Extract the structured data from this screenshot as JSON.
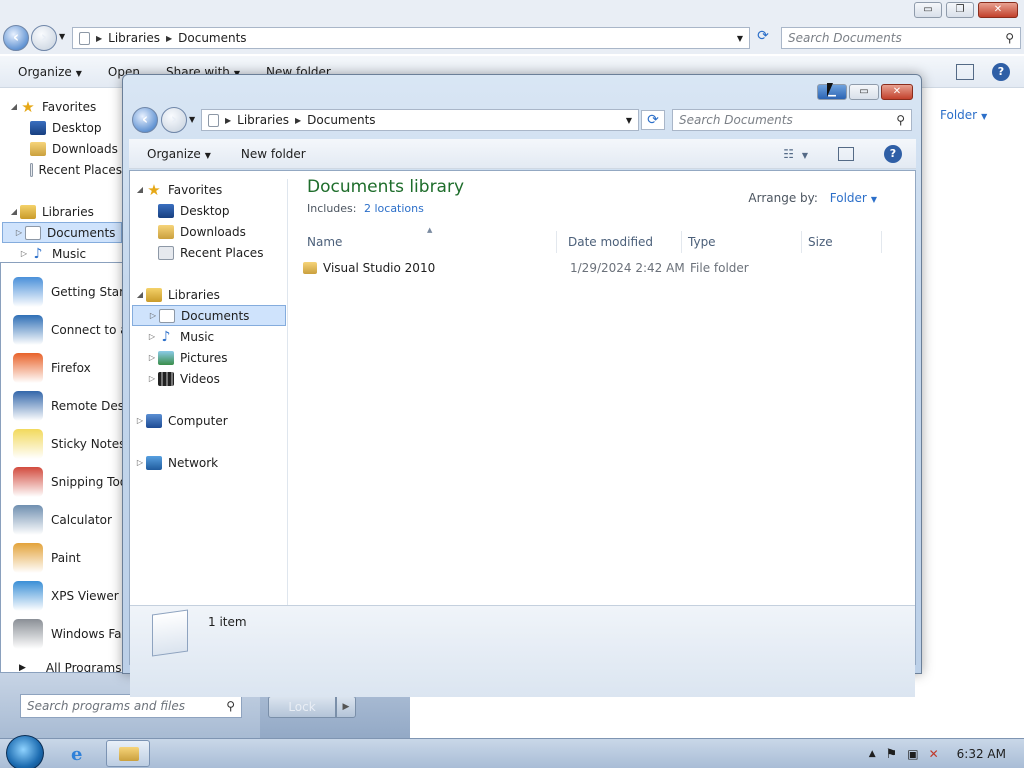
{
  "bg": {
    "caption": {
      "min": "▭",
      "max": "❐",
      "close": "✕"
    },
    "address": {
      "part1": "Libraries",
      "part2": "Documents"
    },
    "search_placeholder": "Search Documents",
    "cmd": {
      "organize": "Organize",
      "open": "Open",
      "share": "Share with",
      "new_folder": "New folder"
    },
    "arrange_value": "Folder",
    "nav": {
      "favorites": "Favorites",
      "desktop": "Desktop",
      "downloads": "Downloads",
      "recent": "Recent Places",
      "libraries": "Libraries",
      "documents": "Documents",
      "music": "Music"
    }
  },
  "start_menu": {
    "items": [
      {
        "label": "Getting Started",
        "color": "#4a90d9"
      },
      {
        "label": "Connect to a Projector",
        "color": "#2f6fb6"
      },
      {
        "label": "Firefox",
        "color": "#e8622a"
      },
      {
        "label": "Remote Desktop Connection",
        "color": "#3366aa"
      },
      {
        "label": "Sticky Notes",
        "color": "#f2d95c"
      },
      {
        "label": "Snipping Tool",
        "color": "#d24b3e"
      },
      {
        "label": "Calculator",
        "color": "#6f8fb0"
      },
      {
        "label": "Paint",
        "color": "#e3a33b"
      },
      {
        "label": "XPS Viewer",
        "color": "#3a8fd6"
      },
      {
        "label": "Windows Fax and Scan",
        "color": "#8a8f96"
      }
    ],
    "all_programs": "All Programs",
    "search_placeholder": "Search programs and files",
    "lock": "Lock"
  },
  "window": {
    "caption": {
      "min": "▁",
      "max": "▭",
      "close": "✕"
    },
    "address": {
      "part1": "Libraries",
      "part2": "Documents"
    },
    "search_placeholder": "Search Documents",
    "cmd": {
      "organize": "Organize",
      "new_folder": "New folder"
    },
    "nav": {
      "favorites": "Favorites",
      "desktop": "Desktop",
      "downloads": "Downloads",
      "recent": "Recent Places",
      "libraries": "Libraries",
      "documents": "Documents",
      "music": "Music",
      "pictures": "Pictures",
      "videos": "Videos",
      "computer": "Computer",
      "network": "Network"
    },
    "library_title": "Documents library",
    "includes_label": "Includes:",
    "includes_link": "2 locations",
    "arrange_label": "Arrange by:",
    "arrange_value": "Folder",
    "columns": {
      "name": "Name",
      "date": "Date modified",
      "type": "Type",
      "size": "Size"
    },
    "files": [
      {
        "name": "Visual Studio 2010",
        "date": "1/29/2024 2:42 AM",
        "type": "File folder",
        "size": ""
      }
    ],
    "status": "1 item"
  },
  "taskbar": {
    "time": "6:32 AM"
  }
}
